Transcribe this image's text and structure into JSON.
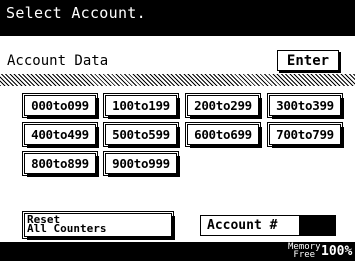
{
  "title": "Select Account.",
  "header": {
    "label": "Account Data",
    "enter_button": "Enter"
  },
  "range_buttons": [
    "000to099",
    "100to199",
    "200to299",
    "300to399",
    "400to499",
    "500to599",
    "600to699",
    "700to799",
    "800to899",
    "900to999"
  ],
  "footer": {
    "reset_button": {
      "line1": "Reset",
      "line2": "All Counters"
    },
    "account_button": "Account #",
    "account_value": ""
  },
  "status": {
    "memory_label_line1": "Memory",
    "memory_label_line2": "Free",
    "memory_percent": "100%"
  }
}
